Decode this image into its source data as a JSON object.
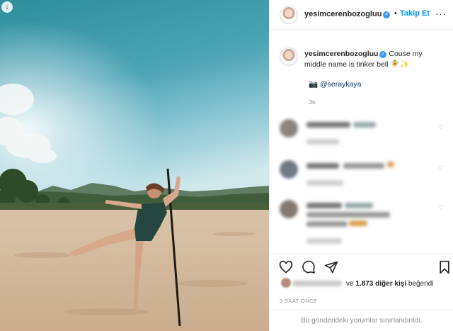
{
  "post": {
    "username": "yesimcerenbozogluu",
    "follow_label": "Takip Et",
    "separator": "•",
    "more_label": "···"
  },
  "caption": {
    "username": "yesimcerenbozogluu",
    "text": "Couse my middle name is tinker bell",
    "emojis": "🧚✨",
    "camera_emoji": "📷",
    "mention": "@seraykaya",
    "time": "3s"
  },
  "likes": {
    "count": "1.873",
    "conjunction": "ve",
    "suffix": "diğer kişi",
    "action": "beğendi"
  },
  "post_time": "3 SAAT ÖNCE",
  "restricted_notice": "Bu gönderideki yorumlar sınırlandırıldı.",
  "icons": {
    "heart": "heart-icon",
    "comment": "comment-icon",
    "share": "share-icon",
    "bookmark": "bookmark-icon",
    "verified": "verified-badge-icon"
  },
  "colors": {
    "follow": "#0095f6",
    "verified": "#3897f0",
    "muted": "#8e8e8e",
    "text": "#262626"
  }
}
